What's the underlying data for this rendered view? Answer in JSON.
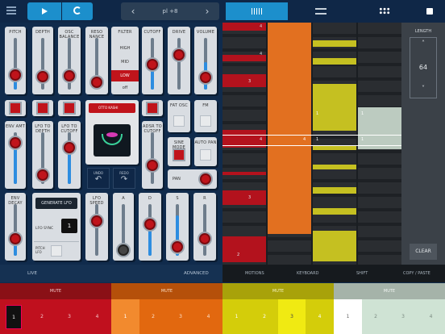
{
  "transport": {
    "pattern": "pl +8"
  },
  "left_panel": {
    "sliders": {
      "pitch": "PITCH",
      "depth": "DEPTH",
      "osc_balance": "OSC BALANCE",
      "resonance": "RESO NANCE",
      "cutoff": "CUTOFF",
      "drive": "DRIVE",
      "volume": "VOLUME",
      "env_amt": "ENV AMT",
      "lfo_to_depth": "LFO TO DEPTH",
      "lfo_to_cutoff": "LFO TO CUTOFF",
      "adsr_to_cutoff": "ADSR TO CUTOFF",
      "env_decay": "ENV DECAY",
      "lfo_speed": "LFO SPEED",
      "a": "A",
      "d": "D",
      "s": "S",
      "r": "R"
    },
    "filter": {
      "label": "FILTER",
      "options": [
        "HIGH",
        "MID",
        "LOW",
        "off"
      ],
      "selected": "LOW"
    },
    "toggles": {
      "fat_osc": "FAT OSC",
      "fm": "FM",
      "sine_mode": "SINE MODE",
      "auto_pan": "AUTO PAN",
      "pan": "PAN"
    },
    "preset": {
      "name": "OTTO KASHI"
    },
    "undo": "UNDO",
    "redo": "REDO",
    "generate_lfo": "GENERATE LFO",
    "lfo_sync": {
      "label": "LFO SYNC",
      "value": "1"
    },
    "pitch_lfo": "PITCH LFO",
    "footer": {
      "live": "LIVE",
      "advanced": "ADVANCED"
    }
  },
  "sequencer": {
    "length": {
      "label": "LENGTH",
      "value": "64"
    },
    "clear": "CLEAR",
    "step_labels": [
      "4",
      "4",
      "3",
      "4",
      "3",
      "2",
      "4",
      "1",
      "1",
      "1",
      "1"
    ],
    "tabs": {
      "motions": "MOTIONS",
      "keyboard": "KEYBOARD",
      "shift": "SHIFT",
      "copy_paste": "COPY / PASTE"
    }
  },
  "tracks": [
    {
      "mute": "MUTE",
      "pads": [
        "1",
        "2",
        "3",
        "4"
      ],
      "color": "#c0101e"
    },
    {
      "mute": "MUTE",
      "pads": [
        "1",
        "2",
        "3",
        "4"
      ],
      "color": "#e2680f"
    },
    {
      "mute": "MUTE",
      "pads": [
        "1",
        "2",
        "3",
        "4"
      ],
      "color": "#d4cd0a"
    },
    {
      "mute": "MUTE",
      "pads": [
        "1",
        "2",
        "3",
        "4"
      ],
      "color": "#cfe3d4"
    }
  ]
}
